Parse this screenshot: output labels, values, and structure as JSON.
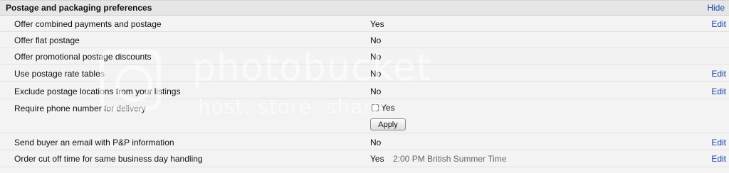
{
  "header": {
    "title": "Postage and packaging preferences",
    "hide_label": "Hide"
  },
  "rows": [
    {
      "label": "Offer combined payments and postage",
      "value": "Yes",
      "edit": "Edit"
    },
    {
      "label": "Offer flat postage",
      "value": "No",
      "edit": ""
    },
    {
      "label": "Offer promotional postage discounts",
      "value": "No",
      "edit": ""
    },
    {
      "label": "Use postage rate tables",
      "value": "No",
      "edit": "Edit"
    },
    {
      "label": "Exclude postage locations from your listings",
      "value": "No",
      "edit": "Edit"
    },
    {
      "label": "Require phone number for delivery",
      "checkbox_label": "Yes",
      "apply_label": "Apply"
    },
    {
      "label": "Send buyer an email with P&P information",
      "value": "No",
      "edit": "Edit"
    },
    {
      "label": "Order cut off time for same business day handling",
      "value": "Yes",
      "subvalue": "2:00 PM British Summer Time",
      "edit": "Edit"
    }
  ],
  "watermark": {
    "brand": "photobucket",
    "tagline": "host. store. share."
  },
  "colors": {
    "link": "#1a44a8",
    "header_bg": "#e6e6e6",
    "panel_bg": "#f3f3f3"
  },
  "icons": [
    "checkbox-icon",
    "photobucket-logo-icon"
  ]
}
